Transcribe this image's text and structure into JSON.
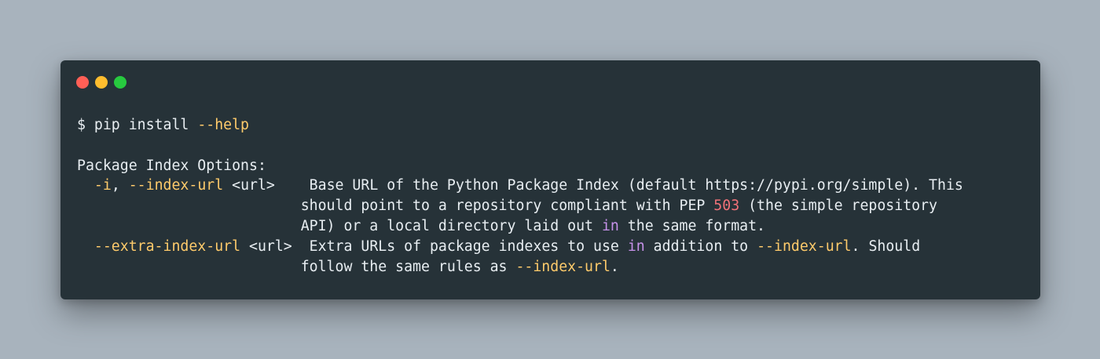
{
  "colors": {
    "background": "#a8b3bd",
    "window": "#263238",
    "text": "#e8eef2",
    "flag": "#ffcb6b",
    "keyword": "#c792ea",
    "number": "#f07178",
    "dot_close": "#ff5f56",
    "dot_minimize": "#ffbd2e",
    "dot_maximize": "#27c93f"
  },
  "window_controls": [
    "close-dot",
    "minimize-dot",
    "maximize-dot"
  ],
  "terminal": {
    "prompt": "$ ",
    "command": "pip install ",
    "command_flag": "--help",
    "section_header": "Package Index Options:",
    "opt1_short": "-i",
    "opt1_sep": ", ",
    "opt1_long": "--index-url",
    "opt1_arg": " <url>    ",
    "opt1_desc_l1": "Base URL of the Python Package Index (default https://pypi.org/simple). This",
    "opt1_desc_l2_a": "should point to a repository compliant with PEP ",
    "opt1_desc_l2_num": "503",
    "opt1_desc_l2_b": " (the simple repository",
    "opt1_desc_l3_a": "API) or a local directory laid out ",
    "opt1_desc_l3_kw": "in",
    "opt1_desc_l3_b": " the same format.",
    "opt2_long": "--extra-index-url",
    "opt2_arg": " <url>  ",
    "opt2_desc_l1_a": "Extra URLs of package indexes to use ",
    "opt2_desc_l1_kw": "in",
    "opt2_desc_l1_b": " addition to ",
    "opt2_desc_l1_flag": "--index-url",
    "opt2_desc_l1_c": ". Should",
    "opt2_desc_l2_a": "follow the same rules as ",
    "opt2_desc_l2_flag": "--index-url",
    "opt2_desc_l2_b": "."
  }
}
